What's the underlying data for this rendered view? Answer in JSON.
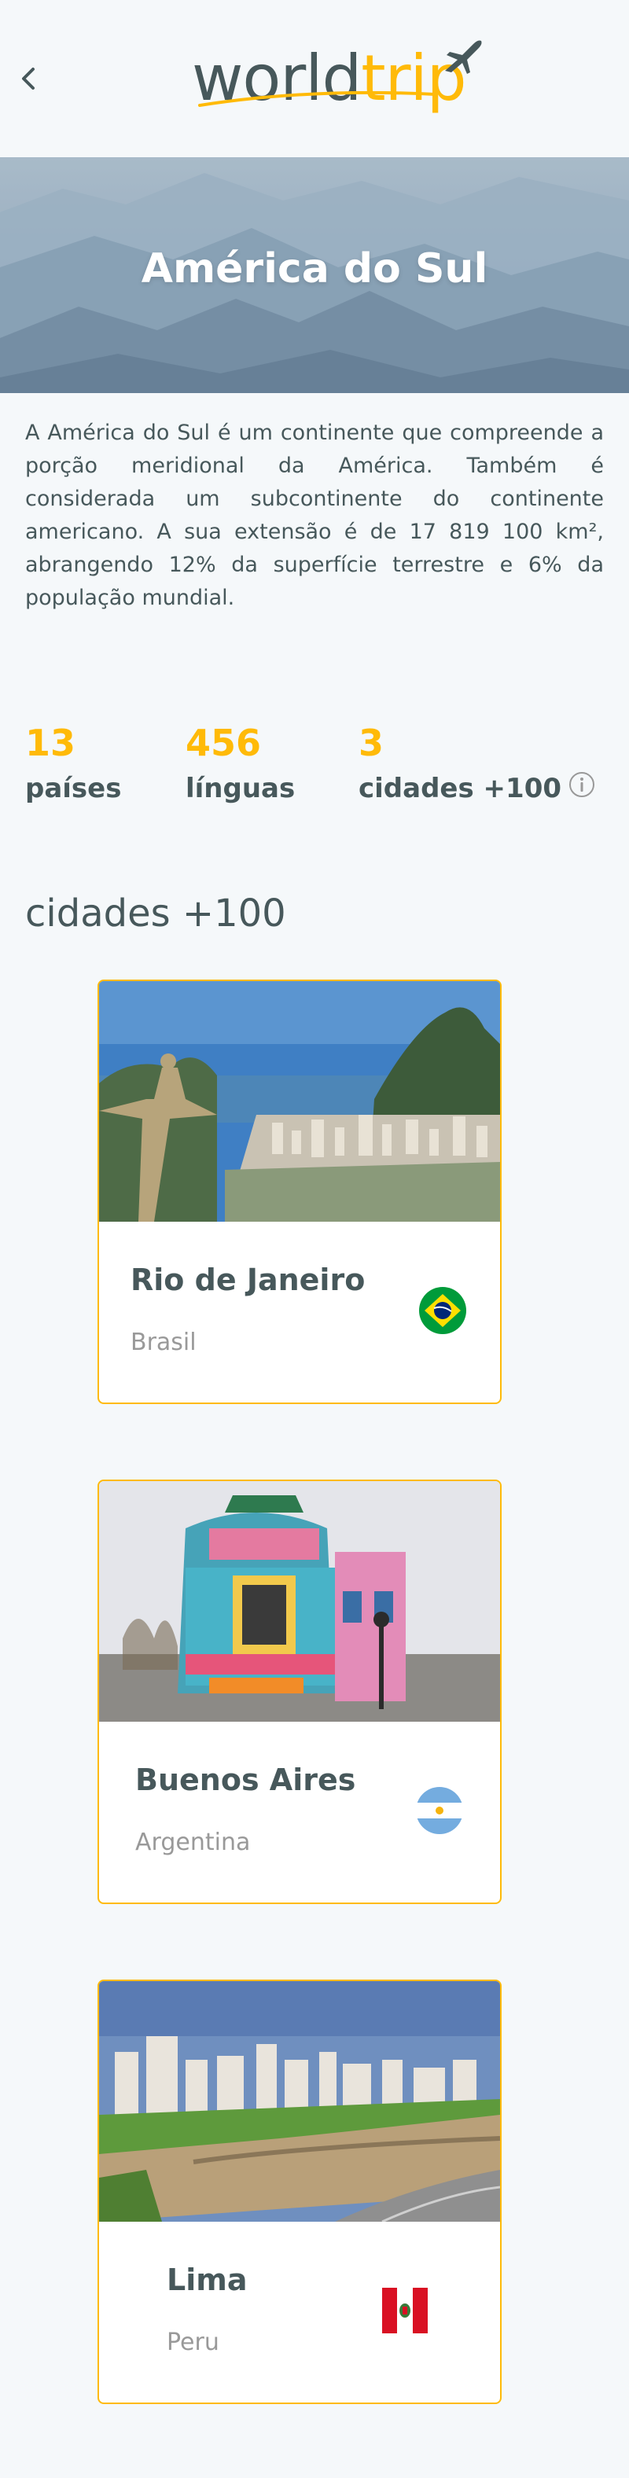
{
  "header": {
    "logo_world": "world",
    "logo_trip": "trip"
  },
  "banner": {
    "title": "América do Sul"
  },
  "description": "A América do Sul é um continente que compreende a porção meridional da América. Também é considerada um subcontinente do continente americano. A sua extensão é de 17 819 100 km², abrangendo 12% da superfície terrestre e 6% da população mundial.",
  "stats": [
    {
      "value": "13",
      "label": "países"
    },
    {
      "value": "456",
      "label": "línguas"
    },
    {
      "value": "3",
      "label": "cidades +100"
    }
  ],
  "section_title": "cidades +100",
  "cities": [
    {
      "name": "Rio de Janeiro",
      "country": "Brasil",
      "flag_icon": "brazil-flag-icon"
    },
    {
      "name": "Buenos Aires",
      "country": "Argentina",
      "flag_icon": "argentina-flag-icon"
    },
    {
      "name": "Lima",
      "country": "Peru",
      "flag_icon": "peru-flag-icon"
    }
  ],
  "colors": {
    "accent": "#ffba08",
    "text": "#47585b",
    "muted": "#999999",
    "background": "#f5f8fa"
  }
}
